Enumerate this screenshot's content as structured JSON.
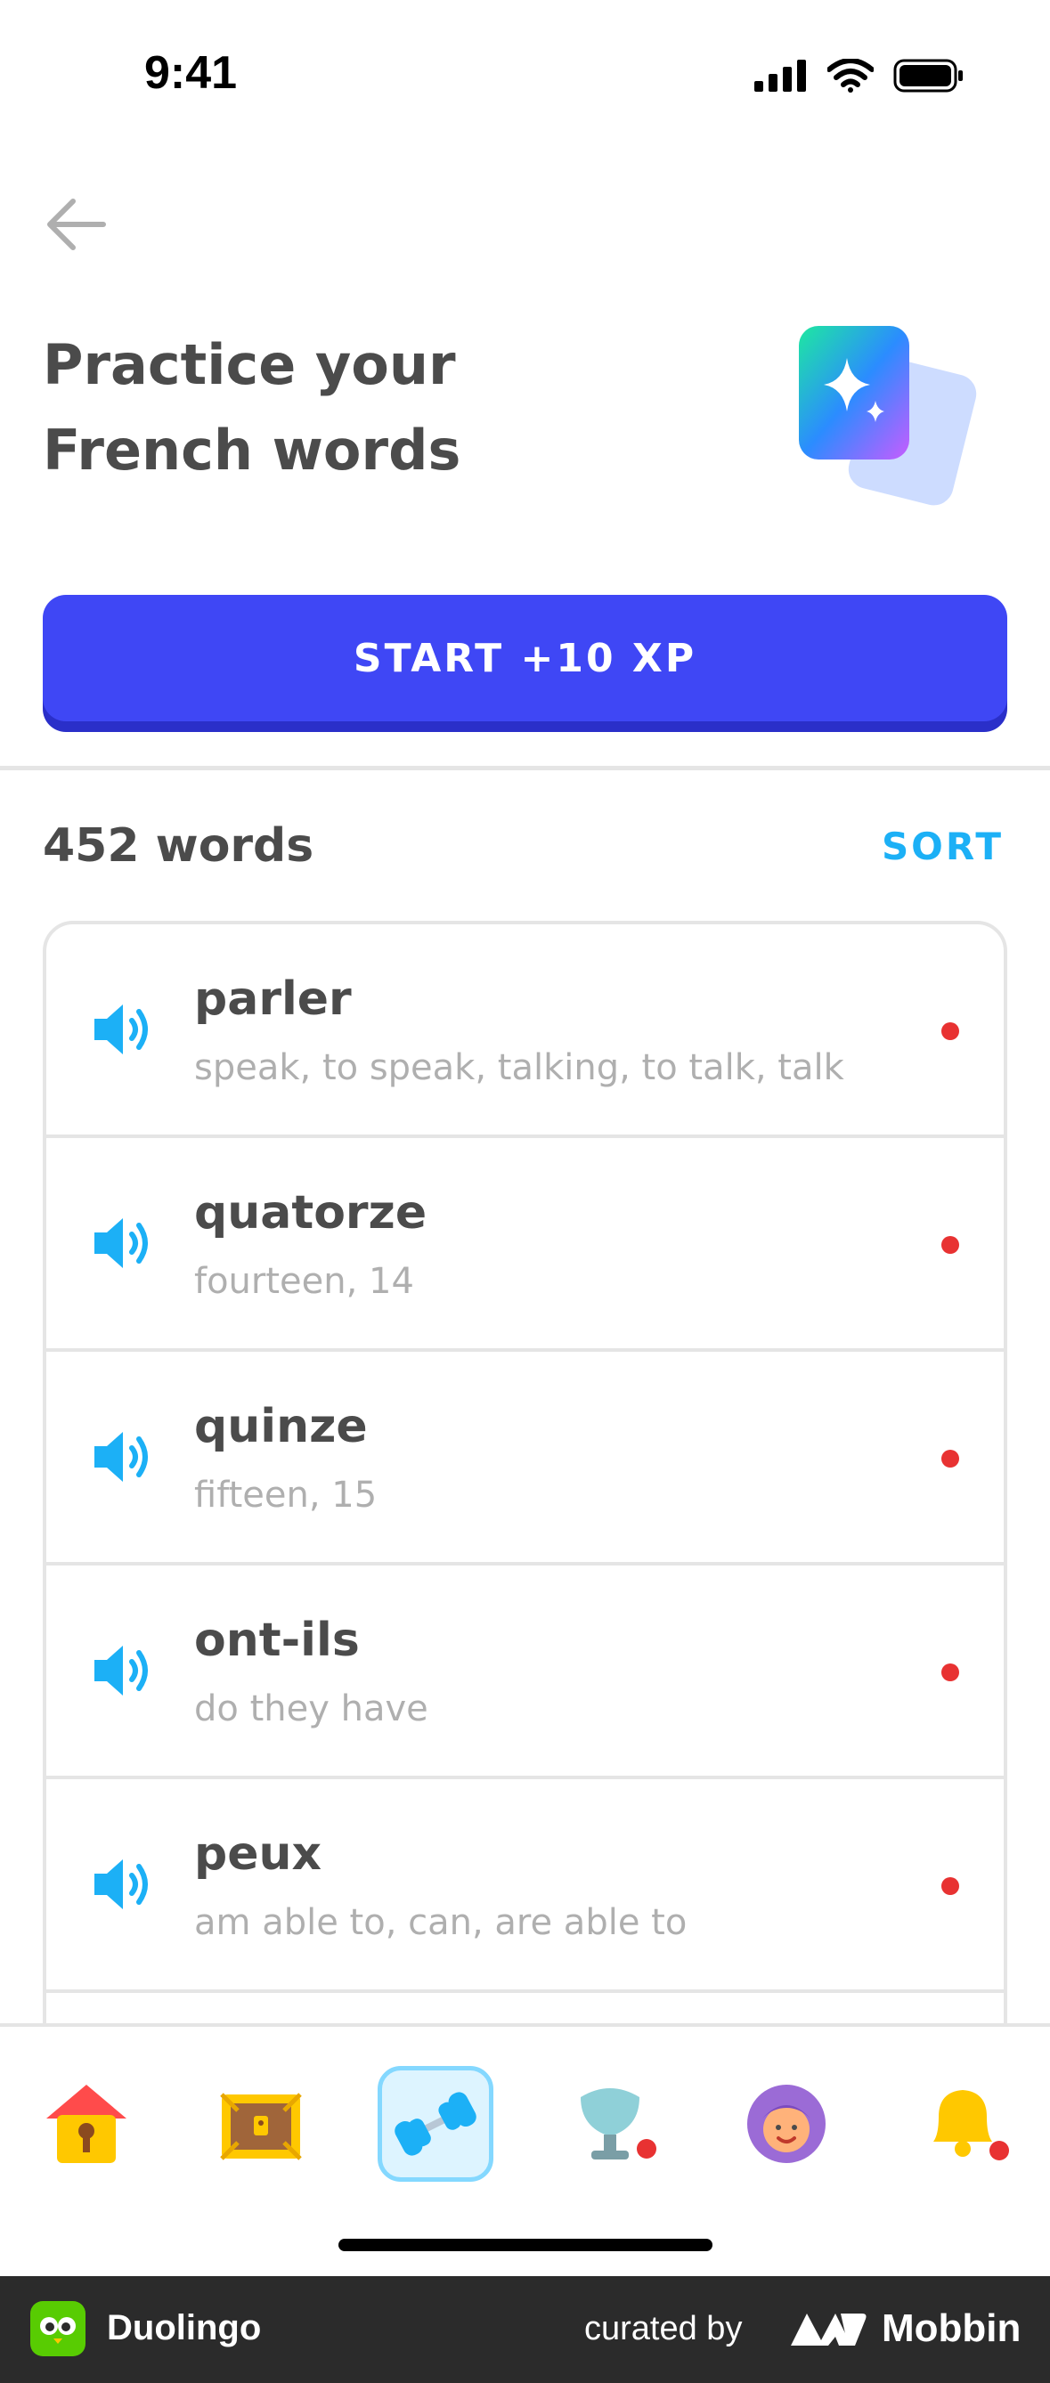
{
  "status_bar": {
    "time": "9:41"
  },
  "header": {
    "title_line1": "Practice your",
    "title_line2": "French words"
  },
  "start_button": {
    "label": "START +10 XP"
  },
  "words_header": {
    "count_label": "452 words",
    "sort_label": "SORT"
  },
  "words": [
    {
      "term": "parler",
      "translations": "speak, to speak, talking, to talk, talk"
    },
    {
      "term": "quatorze",
      "translations": "fourteen, 14"
    },
    {
      "term": "quinze",
      "translations": "fifteen, 15"
    },
    {
      "term": "ont-ils",
      "translations": "do they have"
    },
    {
      "term": "peux",
      "translations": "am able to, can, are able to"
    },
    {
      "term": "",
      "translations": ""
    }
  ],
  "tab_bar": {
    "tabs": [
      {
        "icon": "home-icon"
      },
      {
        "icon": "treasure-chest-icon"
      },
      {
        "icon": "dumbbell-icon",
        "active": true
      },
      {
        "icon": "shield-icon"
      },
      {
        "icon": "profile-avatar-icon"
      },
      {
        "icon": "bell-icon"
      }
    ]
  },
  "footer": {
    "app_name": "Duolingo",
    "curated_by": "curated by",
    "brand": "Mobbin"
  },
  "colors": {
    "accent": "#3f47f5",
    "link": "#1cb0f6",
    "unread_dot": "#e83232"
  }
}
